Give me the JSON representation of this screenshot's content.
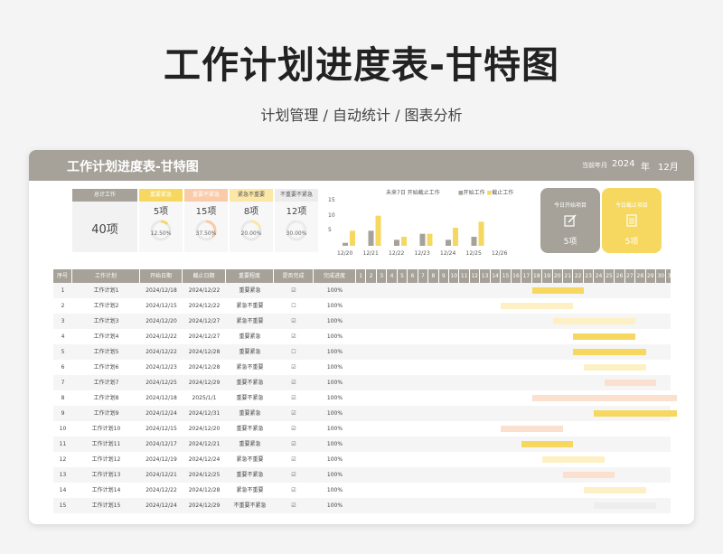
{
  "hero": {
    "title": "工作计划进度表-甘特图",
    "subtitle": "计划管理 / 自动统计 / 图表分析"
  },
  "header": {
    "title": "工作计划进度表-甘特图",
    "date_label": "当前年月",
    "year": "2024",
    "year_unit": "年",
    "month": "12月"
  },
  "colors": {
    "header_gray": "#a6a299",
    "yellow": "#f6d860",
    "light_yellow": "#fbe9a8",
    "peach": "#f9d6c3",
    "light_gray": "#e6e6e6"
  },
  "summary": {
    "total_label": "总计工作",
    "total_value": "40项",
    "categories": [
      {
        "label": "重要紧急",
        "count": "5项",
        "pct": "12.50%",
        "ratio": 0.125,
        "color": "#f6d860",
        "head_text_color": "#ffffff"
      },
      {
        "label": "重要不紧急",
        "count": "15项",
        "pct": "37.50%",
        "ratio": 0.375,
        "color": "#f9cba8",
        "head_text_color": "#ffffff"
      },
      {
        "label": "紧急不重要",
        "count": "8项",
        "pct": "20.00%",
        "ratio": 0.2,
        "color": "#fbe7a6",
        "head_text_color": "#555555"
      },
      {
        "label": "不重要不紧急",
        "count": "12项",
        "pct": "30.00%",
        "ratio": 0.3,
        "color": "#ececec",
        "head_text_color": "#555555"
      }
    ]
  },
  "chart_data": {
    "type": "bar",
    "title": "未来7日 开始截止工作",
    "categories": [
      "12/20",
      "12/21",
      "12/22",
      "12/23",
      "12/24",
      "12/25",
      "12/26"
    ],
    "series": [
      {
        "name": "开始工作",
        "color": "#a6a299",
        "values": [
          1,
          5,
          2,
          4,
          2,
          3,
          0
        ]
      },
      {
        "name": "截止工作",
        "color": "#f6d860",
        "values": [
          5,
          10,
          3,
          4,
          6,
          8,
          0
        ]
      }
    ],
    "yticks": [
      "15",
      "10",
      "5"
    ],
    "ylim": [
      0,
      15
    ]
  },
  "today": [
    {
      "label": "今日开始项目",
      "value": "5项",
      "bg": "#a6a299"
    },
    {
      "label": "今日截止项目",
      "value": "5项",
      "bg": "#f6d860"
    }
  ],
  "table": {
    "headers": {
      "no": "序号",
      "plan": "工作计划",
      "start": "开始日期",
      "end": "截止日期",
      "importance": "重要程度",
      "done": "是否完成",
      "progress": "完成进度"
    },
    "days": [
      "1",
      "2",
      "3",
      "4",
      "5",
      "6",
      "7",
      "8",
      "9",
      "10",
      "11",
      "12",
      "13",
      "14",
      "15",
      "16",
      "17",
      "18",
      "19",
      "20",
      "21",
      "22",
      "23",
      "24",
      "25",
      "26",
      "27",
      "28",
      "29",
      "30",
      "31"
    ],
    "rows": [
      {
        "no": "1",
        "plan": "工作计划1",
        "start": "2024/12/18",
        "end": "2024/12/22",
        "importance": "重要紧急",
        "done": "☑",
        "progress": "100%",
        "bar_start": 18,
        "bar_end": 22,
        "bar_color": "#f6d860"
      },
      {
        "no": "2",
        "plan": "工作计划2",
        "start": "2024/12/15",
        "end": "2024/12/22",
        "importance": "紧急不重要",
        "done": "☐",
        "progress": "100%",
        "bar_start": 15,
        "bar_end": 21,
        "bar_color": "#fdf0c4"
      },
      {
        "no": "3",
        "plan": "工作计划3",
        "start": "2024/12/20",
        "end": "2024/12/27",
        "importance": "紧急不重要",
        "done": "☑",
        "progress": "100%",
        "bar_start": 20,
        "bar_end": 27,
        "bar_color": "#fdf0c4"
      },
      {
        "no": "4",
        "plan": "工作计划4",
        "start": "2024/12/22",
        "end": "2024/12/27",
        "importance": "重要紧急",
        "done": "☑",
        "progress": "100%",
        "bar_start": 22,
        "bar_end": 27,
        "bar_color": "#f6d860"
      },
      {
        "no": "5",
        "plan": "工作计划5",
        "start": "2024/12/22",
        "end": "2024/12/28",
        "importance": "重要紧急",
        "done": "☐",
        "progress": "100%",
        "bar_start": 22,
        "bar_end": 28,
        "bar_color": "#f6d860"
      },
      {
        "no": "6",
        "plan": "工作计划6",
        "start": "2024/12/23",
        "end": "2024/12/28",
        "importance": "紧急不重要",
        "done": "☑",
        "progress": "100%",
        "bar_start": 23,
        "bar_end": 28,
        "bar_color": "#fdf0c4"
      },
      {
        "no": "7",
        "plan": "工作计划7",
        "start": "2024/12/25",
        "end": "2024/12/29",
        "importance": "重要不紧急",
        "done": "☑",
        "progress": "100%",
        "bar_start": 25,
        "bar_end": 29,
        "bar_color": "#fbe0d0"
      },
      {
        "no": "8",
        "plan": "工作计划8",
        "start": "2024/12/18",
        "end": "2025/1/1",
        "importance": "重要不紧急",
        "done": "☑",
        "progress": "100%",
        "bar_start": 18,
        "bar_end": 31,
        "bar_color": "#fbe0d0"
      },
      {
        "no": "9",
        "plan": "工作计划9",
        "start": "2024/12/24",
        "end": "2024/12/31",
        "importance": "重要紧急",
        "done": "☑",
        "progress": "100%",
        "bar_start": 24,
        "bar_end": 31,
        "bar_color": "#f6d860"
      },
      {
        "no": "10",
        "plan": "工作计划10",
        "start": "2024/12/15",
        "end": "2024/12/20",
        "importance": "重要不紧急",
        "done": "☑",
        "progress": "100%",
        "bar_start": 15,
        "bar_end": 20,
        "bar_color": "#fbe0d0"
      },
      {
        "no": "11",
        "plan": "工作计划11",
        "start": "2024/12/17",
        "end": "2024/12/21",
        "importance": "重要紧急",
        "done": "☑",
        "progress": "100%",
        "bar_start": 17,
        "bar_end": 21,
        "bar_color": "#f6d860"
      },
      {
        "no": "12",
        "plan": "工作计划12",
        "start": "2024/12/19",
        "end": "2024/12/24",
        "importance": "紧急不重要",
        "done": "☑",
        "progress": "100%",
        "bar_start": 19,
        "bar_end": 24,
        "bar_color": "#fdf0c4"
      },
      {
        "no": "13",
        "plan": "工作计划13",
        "start": "2024/12/21",
        "end": "2024/12/25",
        "importance": "重要不紧急",
        "done": "☑",
        "progress": "100%",
        "bar_start": 21,
        "bar_end": 25,
        "bar_color": "#fbe0d0"
      },
      {
        "no": "14",
        "plan": "工作计划14",
        "start": "2024/12/22",
        "end": "2024/12/28",
        "importance": "紧急不重要",
        "done": "☑",
        "progress": "100%",
        "bar_start": 23,
        "bar_end": 28,
        "bar_color": "#fdf0c4"
      },
      {
        "no": "15",
        "plan": "工作计划15",
        "start": "2024/12/24",
        "end": "2024/12/29",
        "importance": "不重要不紧急",
        "done": "☑",
        "progress": "100%",
        "bar_start": 24,
        "bar_end": 29,
        "bar_color": "#eeeeee"
      }
    ]
  }
}
